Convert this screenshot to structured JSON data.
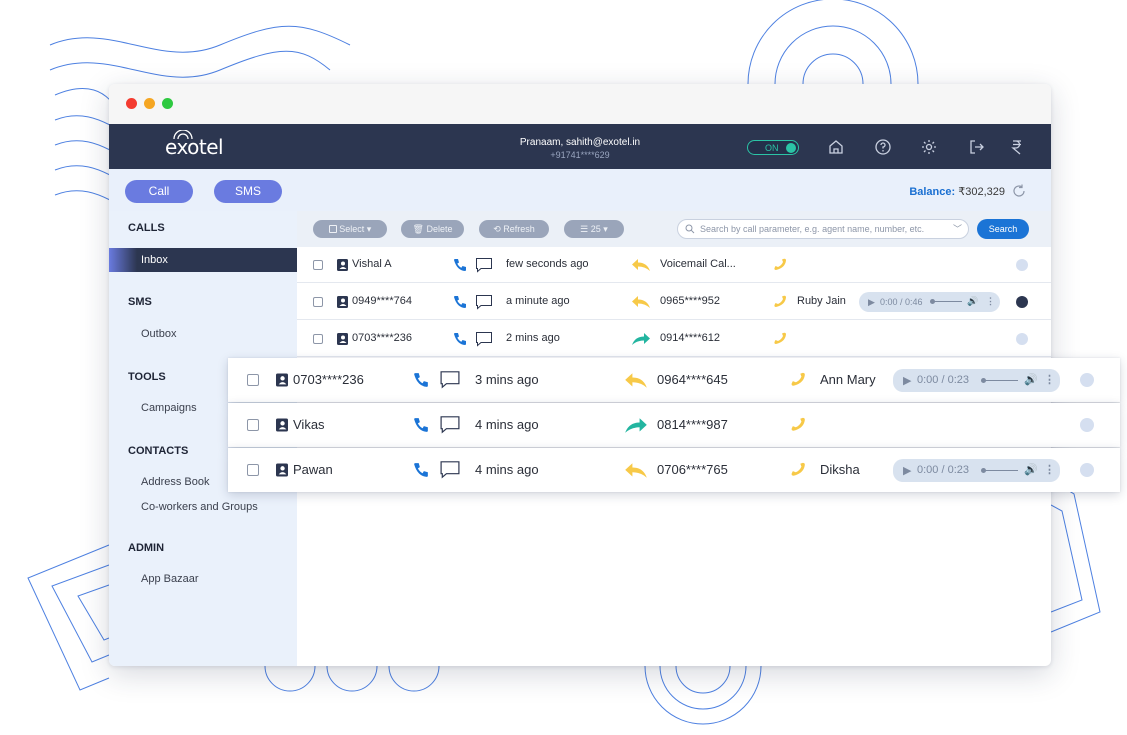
{
  "browser": {
    "dots": [
      "#f43b30",
      "#f5a623",
      "#2ec940"
    ]
  },
  "app": {
    "logo": "exotel",
    "user_line": "Pranaam, sahith@exotel.in",
    "user_phone": "+91741****629",
    "toggle_label": "ON"
  },
  "topnav": {
    "icons": [
      "home-icon",
      "help-icon",
      "settings-icon",
      "logout-icon",
      "rupee-icon"
    ]
  },
  "subbar": {
    "call_label": "Call",
    "sms_label": "SMS",
    "balance_label": "Balance:",
    "balance_value": "₹302,329"
  },
  "sidebar": {
    "calls_header": "CALLS",
    "inbox": "Inbox",
    "sms_header": "SMS",
    "outbox": "Outbox",
    "tools_header": "TOOLS",
    "campaigns": "Campaigns",
    "contacts_header": "CONTACTS",
    "address_book": "Address Book",
    "coworkers": "Co-workers and Groups",
    "admin_header": "ADMIN",
    "app_bazaar": "App Bazaar"
  },
  "toolbar": {
    "select": "Select",
    "delete": "Delete",
    "refresh": "Refresh",
    "per_page": "25",
    "search_placeholder": "Search by call parameter, e.g. agent name, number, etc.",
    "search_button": "Search"
  },
  "rows": [
    {
      "contact": "Vishal A",
      "time": "few seconds ago",
      "direction": "incoming",
      "number": "Voicemail Cal...",
      "agent": "",
      "player": "",
      "status": "#d5dff0"
    },
    {
      "contact": "0949****764",
      "time": "a minute ago",
      "direction": "incoming",
      "number": "0965****952",
      "agent": "Ruby Jain",
      "player": "0:00 / 0:46",
      "status": "#2c3650"
    },
    {
      "contact": "0703****236",
      "time": "2 mins ago",
      "direction": "outgoing",
      "number": "0914****612",
      "agent": "",
      "player": "",
      "status": "#d5dff0"
    }
  ],
  "floating_rows": [
    {
      "contact": "0703****236",
      "time": "3 mins ago",
      "direction": "incoming",
      "number": "0964****645",
      "agent": "Ann Mary",
      "player": "0:00 / 0:23"
    },
    {
      "contact": "Vikas",
      "time": "4 mins ago",
      "direction": "outgoing",
      "number": "0814****987",
      "agent": "",
      "player": ""
    },
    {
      "contact": "Pawan",
      "time": "4 mins ago",
      "direction": "incoming",
      "number": "0706****765",
      "agent": "Diksha",
      "player": "0:00 / 0:23"
    }
  ],
  "colors": {
    "navy": "#2c3650",
    "accent": "#6a7be0",
    "phone_blue": "#1b74d6",
    "incoming_yellow": "#f7c948",
    "outgoing_teal": "#23b5a0"
  }
}
